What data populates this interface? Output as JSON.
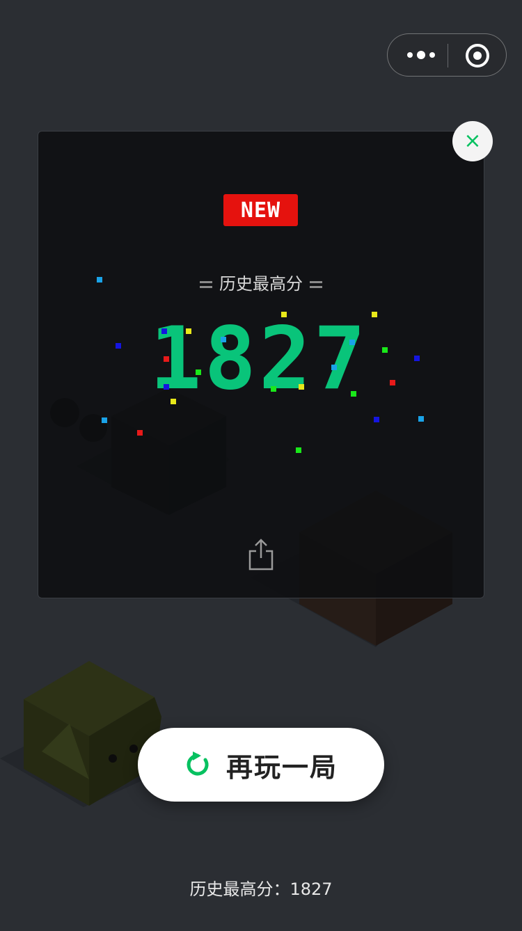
{
  "app": {
    "background": "#2b2e33"
  },
  "capsule": {
    "more_icon": "more-dots-icon",
    "close_icon": "target-icon"
  },
  "result_card": {
    "close_symbol": "×",
    "badge": "NEW",
    "best_label": "历史最高分",
    "score": "1827",
    "score_color": "#09c47a",
    "share_icon": "share-icon"
  },
  "replay": {
    "label": "再玩一局",
    "icon": "replay-icon",
    "accent": "#07c160"
  },
  "footer": {
    "best_text": "历史最高分：1827"
  },
  "confetti_colors": [
    "#1aa3e8",
    "#1515e0",
    "#e8e81a",
    "#e81a1a",
    "#1ae81a"
  ]
}
